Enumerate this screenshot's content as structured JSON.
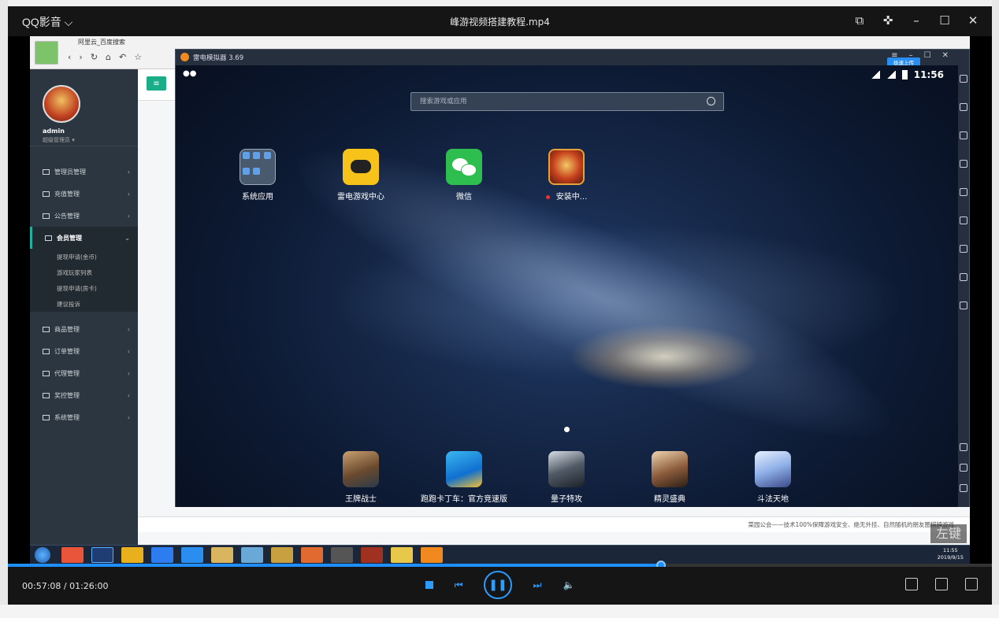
{
  "player": {
    "brand": "QQ影音",
    "file_title": "峰游视频搭建教程.mp4",
    "time": "00:57:08 / 01:26:00",
    "progress_fraction": 0.664
  },
  "browser": {
    "tab_title": "阿里云_百度搜索"
  },
  "admin": {
    "name": "admin",
    "role": "超级管理员",
    "menu": [
      {
        "label": "管理员管理"
      },
      {
        "label": "充值管理"
      },
      {
        "label": "公告管理"
      },
      {
        "label": "会员管理"
      },
      {
        "label": "商品管理"
      },
      {
        "label": "订单管理"
      },
      {
        "label": "代理管理"
      },
      {
        "label": "奖控管理"
      },
      {
        "label": "系统管理"
      }
    ],
    "submenu": [
      "提现申请(金币)",
      "游戏玩家列表",
      "提现申请(房卡)",
      "建议投诉"
    ],
    "footer": "菜园公会——技术100%保障游戏安全、绝无外挂、自然随机的朋友圈棋牌游戏"
  },
  "emulator": {
    "title": "雷电模拟器 3.69",
    "badge": "极速上传",
    "clock": "11:56",
    "search_placeholder": "搜索游戏或应用",
    "apps": [
      {
        "label": "系统应用"
      },
      {
        "label": "雷电游戏中心"
      },
      {
        "label": "微信"
      },
      {
        "label": "安装中..."
      }
    ],
    "dock": [
      {
        "label": "王牌战士"
      },
      {
        "label": "跑跑卡丁车：官方竞速版"
      },
      {
        "label": "量子特攻"
      },
      {
        "label": "精灵盛典"
      },
      {
        "label": "斗法天地"
      }
    ]
  },
  "overlay": {
    "left_key": "左键"
  },
  "taskbar": {
    "time": "11:55",
    "date": "2019/9/15"
  },
  "colors": {
    "accent": "#2d9cff",
    "admin_green": "#1aae88",
    "sidebar": "#2b3640"
  }
}
